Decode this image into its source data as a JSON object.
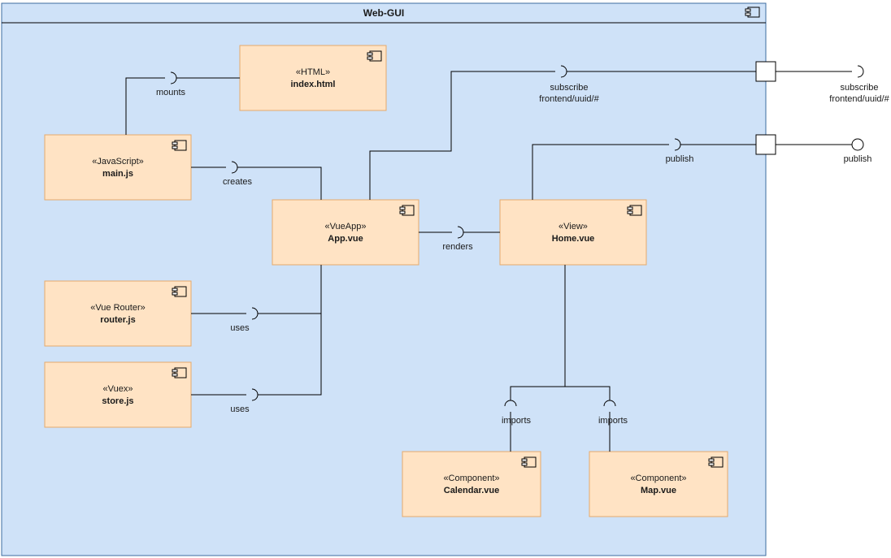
{
  "container": {
    "title": "Web-GUI"
  },
  "components": {
    "html": {
      "stereo": "«HTML»",
      "name": "index.html"
    },
    "main": {
      "stereo": "«JavaScript»",
      "name": "main.js"
    },
    "app": {
      "stereo": "«VueApp»",
      "name": "App.vue"
    },
    "router": {
      "stereo": "«Vue Router»",
      "name": "router.js"
    },
    "store": {
      "stereo": "«Vuex»",
      "name": "store.js"
    },
    "home": {
      "stereo": "«View»",
      "name": "Home.vue"
    },
    "calendar": {
      "stereo": "«Component»",
      "name": "Calendar.vue"
    },
    "map": {
      "stereo": "«Component»",
      "name": "Map.vue"
    }
  },
  "labels": {
    "mounts": "mounts",
    "creates": "creates",
    "renders": "renders",
    "uses1": "uses",
    "uses2": "uses",
    "imports1": "imports",
    "imports2": "imports",
    "publish": "publish",
    "publish2": "publish",
    "subscribe": "subscribe",
    "subscribe_topic": "frontend/uuid/#",
    "subscribe2": "subscribe",
    "subscribe2_topic": "frontend/uuid/#"
  }
}
